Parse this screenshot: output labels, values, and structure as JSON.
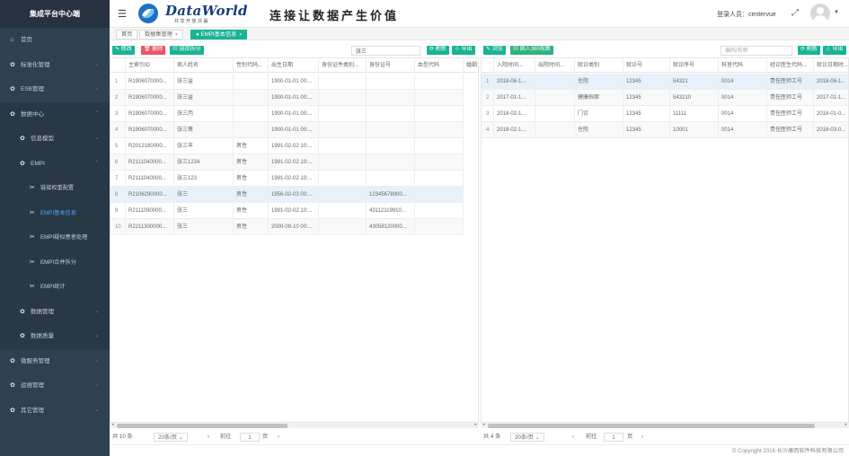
{
  "sidebar": {
    "title": "集成平台中心端",
    "items": [
      {
        "label": "首页",
        "icon": "home-icon",
        "glyph": "⌂"
      },
      {
        "label": "标准化管理",
        "icon": "gear-icon",
        "glyph": "✿"
      },
      {
        "label": "ESB管理",
        "icon": "gear-icon",
        "glyph": "✿"
      },
      {
        "label": "数据中心",
        "icon": "gear-icon",
        "glyph": "✿"
      }
    ],
    "data_center_sub": [
      {
        "label": "信息模型"
      },
      {
        "label": "EMPI"
      }
    ],
    "empi_sub": [
      {
        "label": "链接权重配置"
      },
      {
        "label": "EMPI基本信息"
      },
      {
        "label": "EMPI疑似患者处理"
      },
      {
        "label": "EMPI合并拆分"
      },
      {
        "label": "EMPI统计"
      }
    ],
    "data_center_sub2": [
      {
        "label": "数据管理"
      },
      {
        "label": "数据质量"
      }
    ],
    "items_bottom": [
      {
        "label": "微服务管理"
      },
      {
        "label": "运维管理"
      },
      {
        "label": "其它管理"
      }
    ]
  },
  "header": {
    "logo_text": "DataWorld",
    "logo_sub": "共享开放共赢",
    "slogan": "连接让数据产生价值",
    "login_label": "登录人员：centervue"
  },
  "tabs": [
    {
      "label": "首页"
    },
    {
      "label": "数据集管理"
    },
    {
      "label": "EMPI基本信息"
    }
  ],
  "left_toolbar": {
    "edit": "修改",
    "delete": "删除",
    "split": "链接拆分",
    "search_value": "张三",
    "refresh": "刷新",
    "export": "导出"
  },
  "right_toolbar": {
    "browse": "浏览",
    "view360": "病人360视图",
    "search_placeholder": "编码/名称",
    "refresh": "刷新",
    "export": "导出"
  },
  "left_table": {
    "columns": [
      "",
      "主索引ID",
      "病人姓名",
      "性别代码...",
      "出生日期",
      "身份证件类别...",
      "身份证号",
      "血型代码",
      "婚姻"
    ],
    "rows": [
      [
        "1",
        "R1906070000...",
        "张三益",
        "",
        "1900-01-01 00:...",
        "",
        "",
        ""
      ],
      [
        "2",
        "R1906070000...",
        "张三益",
        "",
        "1900-01-01 00:...",
        "",
        "",
        ""
      ],
      [
        "3",
        "R1906070000...",
        "张三丙",
        "",
        "1900-01-01 00:...",
        "",
        "",
        ""
      ],
      [
        "4",
        "R1906070000...",
        "张三蔡",
        "",
        "1900-01-01 00:...",
        "",
        "",
        ""
      ],
      [
        "5",
        "R2012180000...",
        "张三丰",
        "男性",
        "1991-02-02 10:...",
        "",
        "",
        ""
      ],
      [
        "6",
        "R2111040000...",
        "张三1234",
        "男性",
        "1991-02-02 10:...",
        "",
        "",
        ""
      ],
      [
        "7",
        "R2111040000...",
        "张三123",
        "男性",
        "1991-02-02 10:...",
        "",
        "",
        ""
      ],
      [
        "8",
        "R2106290000...",
        "张三",
        "男性",
        "1956-02-03 00:...",
        "",
        "12345678900...",
        ""
      ],
      [
        "9",
        "R2111090000...",
        "张三",
        "男性",
        "1991-02-02 10:...",
        "",
        "43112119910...",
        ""
      ],
      [
        "10",
        "R2211300000...",
        "张三",
        "男性",
        "2000-09-10 00:...",
        "",
        "43058120000...",
        ""
      ]
    ]
  },
  "right_table": {
    "columns": [
      "",
      "入院时间...",
      "出院时间...",
      "就诊类别",
      "就诊号",
      "就诊序号",
      "科室代码",
      "经诊医生代码...",
      "就诊日期时..."
    ],
    "rows": [
      [
        "1",
        "2018-06-1...",
        "",
        "住院",
        "12345",
        "54321",
        "0014",
        "责任医师工号",
        "2018-06-1..."
      ],
      [
        "2",
        "2017-01-1...",
        "",
        "健康档案",
        "12345",
        "543210",
        "0014",
        "责任医师工号",
        "2017-01-1..."
      ],
      [
        "3",
        "2018-02-1...",
        "",
        "门诊",
        "12345",
        "11111",
        "0014",
        "责任医师工号",
        "2018-01-0..."
      ],
      [
        "4",
        "2018-02-1...",
        "",
        "住院",
        "12345",
        "10001",
        "0014",
        "责任医师工号",
        "2018-03-0..."
      ]
    ]
  },
  "left_pager": {
    "total": "共 10 条",
    "page_size": "20条/页",
    "goto": "前往",
    "page": "1",
    "unit": "页"
  },
  "right_pager": {
    "total": "共 4 条",
    "page_size": "20条/页",
    "goto": "前往",
    "page": "1",
    "unit": "页"
  },
  "footer": "© Copyright 2016 长沙康而软件科技有限公司",
  "colors": {
    "sidebar": "#2f4050",
    "accent": "#1ab394",
    "danger": "#ed5565",
    "selected_row": "#e6f1fc"
  }
}
